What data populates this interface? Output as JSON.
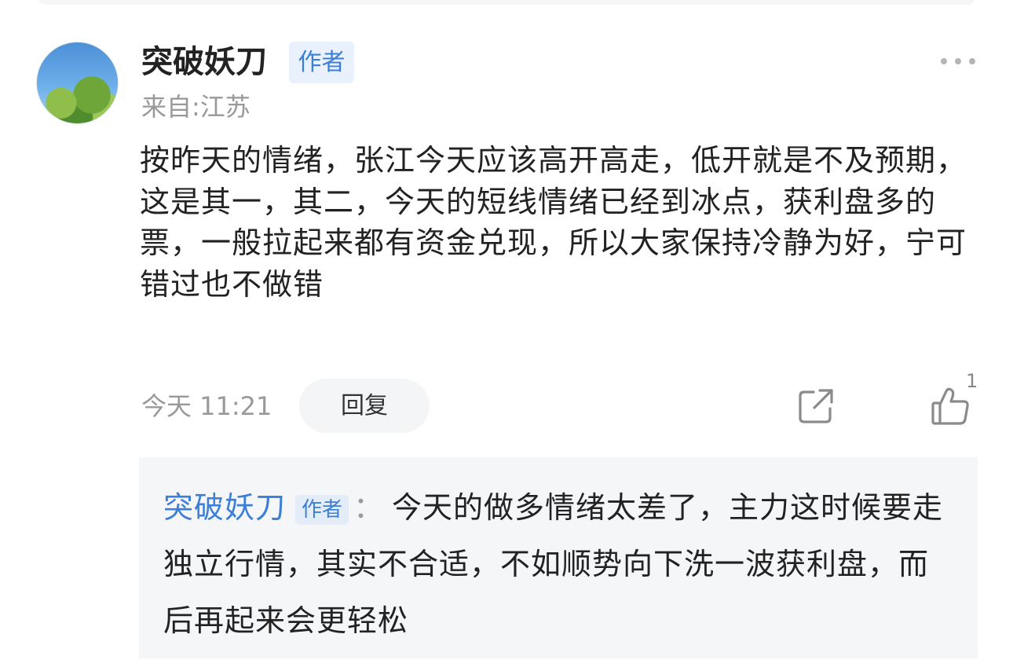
{
  "comment": {
    "author": "突破妖刀",
    "author_badge": "作者",
    "location": "来自:江苏",
    "text": "按昨天的情绪，张江今天应该高开高走，低开就是不及预期，这是其一，其二，今天的短线情绪已经到冰点，获利盘多的票，一般拉起来都有资金兑现，所以大家保持冷静为好，宁可错过也不做错",
    "time": "今天 11:21",
    "reply_label": "回复",
    "like_count": "1"
  },
  "reply": {
    "author": "突破妖刀",
    "author_badge": "作者",
    "colon": "：",
    "text": "今天的做多情绪太差了，主力这时候要走独立行情，其实不合适，不如顺势向下洗一波获利盘，而后再起来会更轻松"
  },
  "icons": {
    "more": "more-dots-icon",
    "share": "share-icon",
    "like": "thumbs-up-icon"
  },
  "colors": {
    "accent": "#3b7fd6",
    "badge_bg": "#e8f1fc",
    "muted_text": "#999999",
    "reply_bg": "#f5f6f8"
  }
}
